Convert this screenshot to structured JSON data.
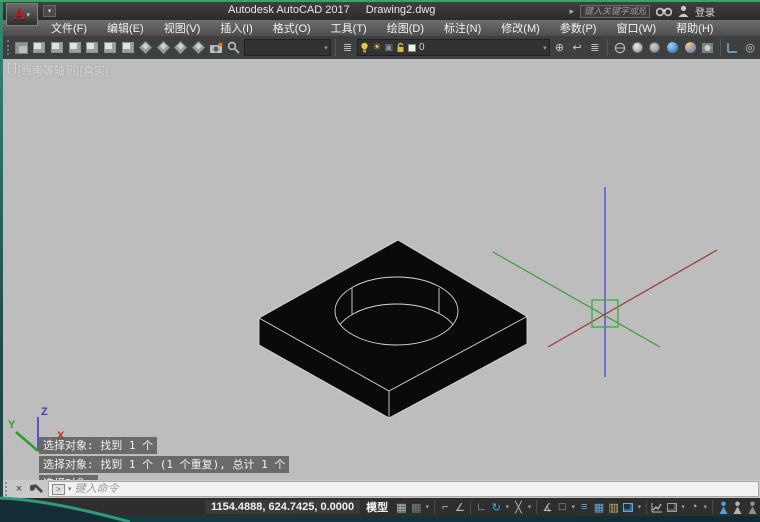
{
  "titlebar": {
    "app_title": "Autodesk AutoCAD 2017",
    "doc_title": "Drawing2.dwg",
    "search_placeholder": "键入关键字或短语",
    "signin": "登录"
  },
  "menu": {
    "items": [
      "文件(F)",
      "编辑(E)",
      "视图(V)",
      "插入(I)",
      "格式(O)",
      "工具(T)",
      "绘图(D)",
      "标注(N)",
      "修改(M)",
      "参数(P)",
      "窗口(W)",
      "帮助(H)"
    ]
  },
  "toolbar": {
    "layer_name": "0"
  },
  "canvas": {
    "viewport_controls": [
      "[-]",
      "[西南等轴测]",
      "[真实]"
    ],
    "ucs_labels": {
      "x": "X",
      "y": "Y",
      "z": "Z"
    },
    "command_history": [
      "选择对象: 找到 1 个",
      "选择对象: 找到 1 个 (1 个重复), 总计 1 个",
      "选择对象:"
    ]
  },
  "command": {
    "placeholder": "键入命令",
    "prompt": ">"
  },
  "statusbar": {
    "coords": "1154.4888, 624.7425, 0.0000",
    "model_label": "模型"
  },
  "glyphs": {
    "caret_down": "▾",
    "play": "▸",
    "close": "×",
    "sun": "☀",
    "grid": "▦",
    "ortho": "⌐",
    "polar": "∠",
    "isodraft": "∟",
    "isoplane": "↻",
    "osnap_track": "╳",
    "infer": "∡",
    "osnap_square": "□",
    "lineweight": "≡",
    "transparency": "▦",
    "selection_cycle": "▥",
    "annotation_scale": "◔",
    "layer_props": "≣",
    "freeze": "▣",
    "layer_current": "⊕",
    "layer_prev": "↩",
    "layer_states": "≣",
    "named_ucs": "◎"
  },
  "colors": {
    "axis_red": "#a03535",
    "axis_green": "#3b9c3b",
    "axis_blue": "#3c3cc8",
    "pickbox_green": "#3fae49",
    "canvas_gray": "#bdbdbd",
    "desktop_teal": "#2f8f74"
  }
}
